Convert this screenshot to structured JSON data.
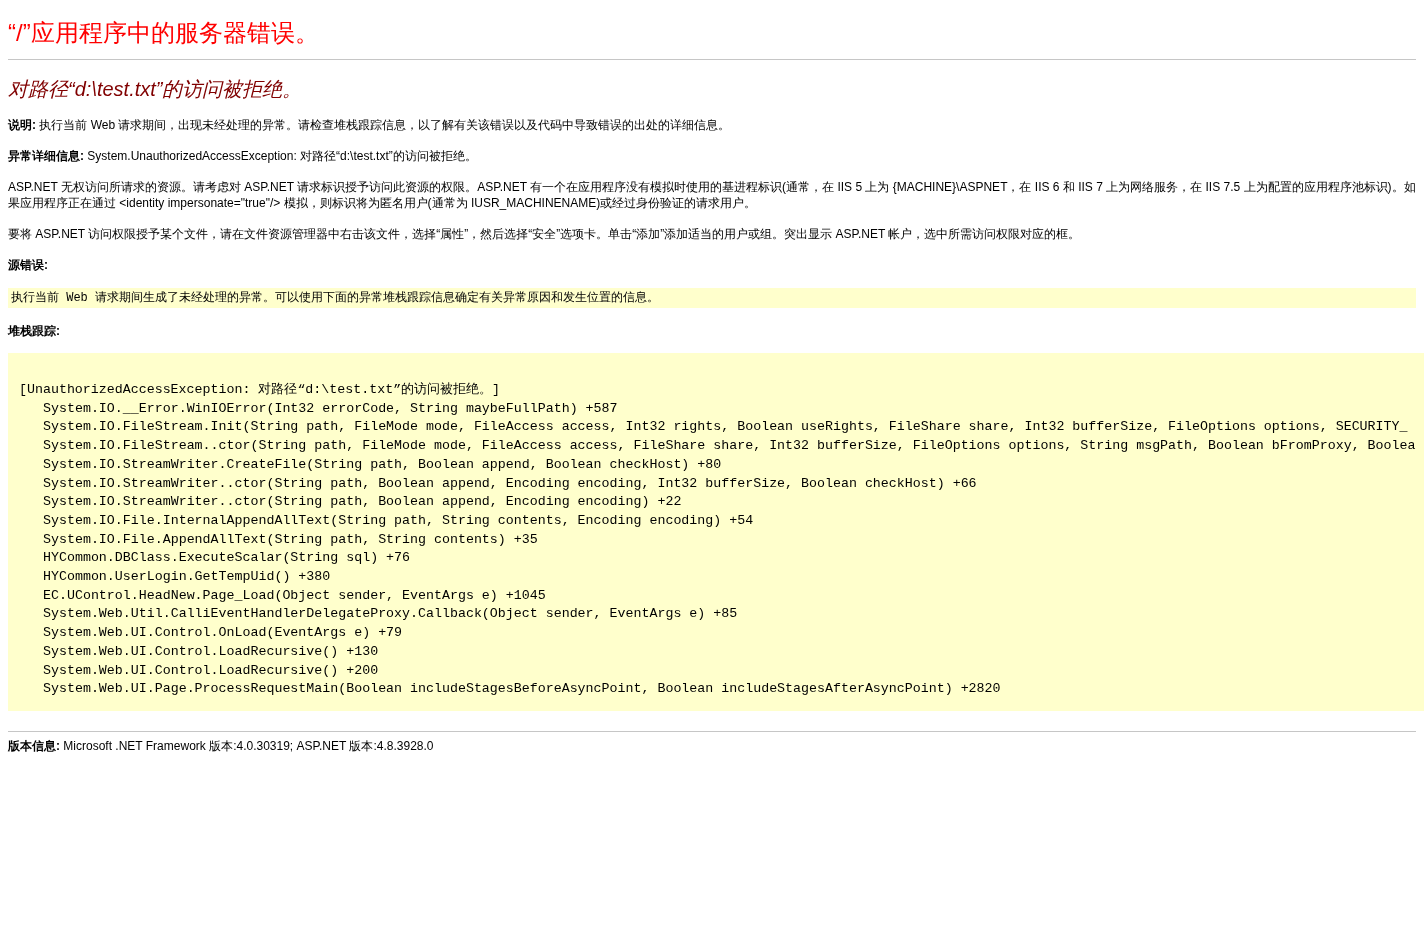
{
  "title": "“/”应用程序中的服务器错误。",
  "error_message": "对路径“d:\\test.txt”的访问被拒绝。",
  "description": "**说明:** 执行当前 Web 请求期间，出现未经处理的异常。请检查堆栈跟踪信息，以了解有关该错误以及代码中导致错误的出处的详细信息。",
  "exception_details": "**异常详细信息:** System.UnauthorizedAccessException: 对路径“d:\\test.txt”的访问被拒绝。",
  "paragraphs": [
    "ASP.NET 无权访问所请求的资源。请考虑对 ASP.NET 请求标识授予访问此资源的权限。ASP.NET 有一个在应用程序没有模拟时使用的基进程标识(通常，在 IIS 5 上为 {MACHINE}\\ASPNET，在 IIS 6 和 IIS 7 上为网络服务，在 IIS 7.5 上为配置的应用程序池标识)。如果应用程序正在通过 <identity impersonate=\"true\"/> 模拟，则标识将为匿名用户(通常为 IUSR_MACHINENAME)或经过身份验证的请求用户。",
    "要将 ASP.NET 访问权限授予某个文件，请在文件资源管理器中右击该文件，选择“属性”，然后选择“安全”选项卡。单击“添加”添加适当的用户或组。突出显示 ASP.NET 帐户，选中所需访问权限对应的框。"
  ],
  "source_error": {
    "heading": "源错误:",
    "text": "执行当前 Web 请求期间生成了未经处理的异常。可以使用下面的异常堆栈跟踪信息确定有关异常原因和发生位置的信息。"
  },
  "stack_trace": {
    "heading": "堆栈跟踪:",
    "exception": "[UnauthorizedAccessException: 对路径“d:\\test.txt”的访问被拒绝。]",
    "frames": [
      "System.IO.__Error.WinIOError(Int32 errorCode, String maybeFullPath) +587",
      "System.IO.FileStream.Init(String path, FileMode mode, FileAccess access, Int32 rights, Boolean useRights, FileShare share, Int32 bufferSize, FileOptions options, SECURITY_",
      "System.IO.FileStream..ctor(String path, FileMode mode, FileAccess access, FileShare share, Int32 bufferSize, FileOptions options, String msgPath, Boolean bFromProxy, Boolea",
      "System.IO.StreamWriter.CreateFile(String path, Boolean append, Boolean checkHost) +80",
      "System.IO.StreamWriter..ctor(String path, Boolean append, Encoding encoding, Int32 bufferSize, Boolean checkHost) +66",
      "System.IO.StreamWriter..ctor(String path, Boolean append, Encoding encoding) +22",
      "System.IO.File.InternalAppendAllText(String path, String contents, Encoding encoding) +54",
      "System.IO.File.AppendAllText(String path, String contents) +35",
      "HYCommon.DBClass.ExecuteScalar(String sql) +76",
      "HYCommon.UserLogin.GetTempUid() +380",
      "EC.UControl.HeadNew.Page_Load(Object sender, EventArgs e) +1045",
      "System.Web.Util.CalliEventHandlerDelegateProxy.Callback(Object sender, EventArgs e) +85",
      "System.Web.UI.Control.OnLoad(EventArgs e) +79",
      "System.Web.UI.Control.LoadRecursive() +130",
      "System.Web.UI.Control.LoadRecursive() +200",
      "System.Web.UI.Page.ProcessRequestMain(Boolean includeStagesBeforeAsyncPoint, Boolean includeStagesAfterAsyncPoint) +2820"
    ]
  },
  "version_info": "**版本信息:** Microsoft .NET Framework 版本:4.0.30319; ASP.NET 版本:4.8.3928.0"
}
